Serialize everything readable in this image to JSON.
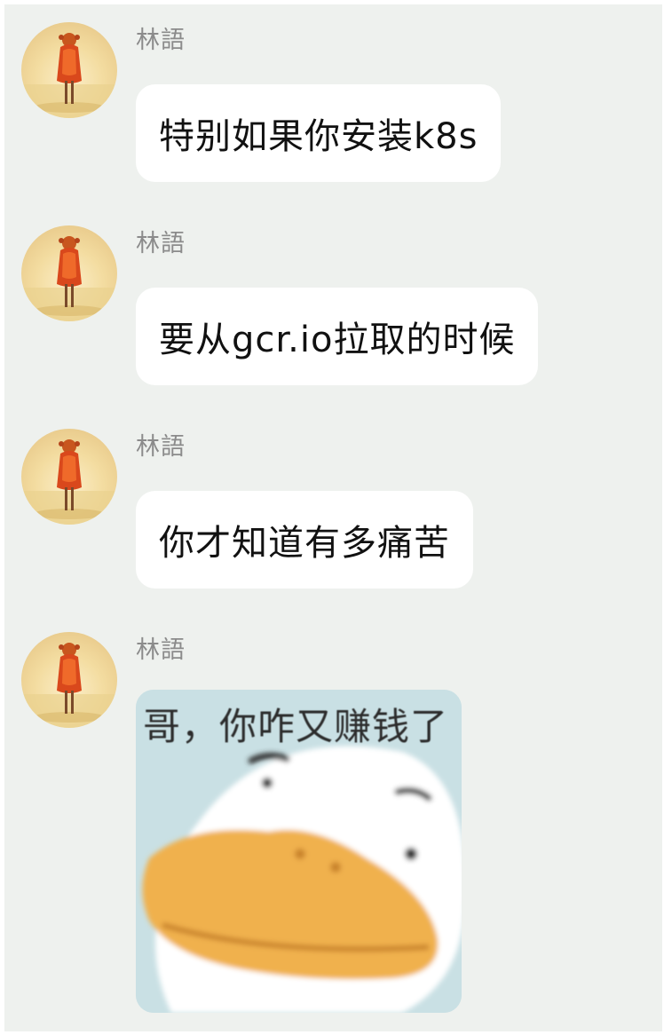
{
  "conversation": {
    "messages": [
      {
        "sender": "林語",
        "text": "特别如果你安装k8s"
      },
      {
        "sender": "林語",
        "text": "要从gcr.io拉取的时候"
      },
      {
        "sender": "林語",
        "text": "你才知道有多痛苦"
      },
      {
        "sender": "林語",
        "sticker_caption": "哥，你咋又赚钱了"
      }
    ]
  },
  "colors": {
    "background": "#eef1ee",
    "bubble": "#ffffff",
    "sender_name": "#8b8b8b",
    "text": "#111111"
  },
  "icons": {
    "avatar": "avatar-girl-in-orange-dress",
    "sticker": "duck-sticker-image"
  }
}
